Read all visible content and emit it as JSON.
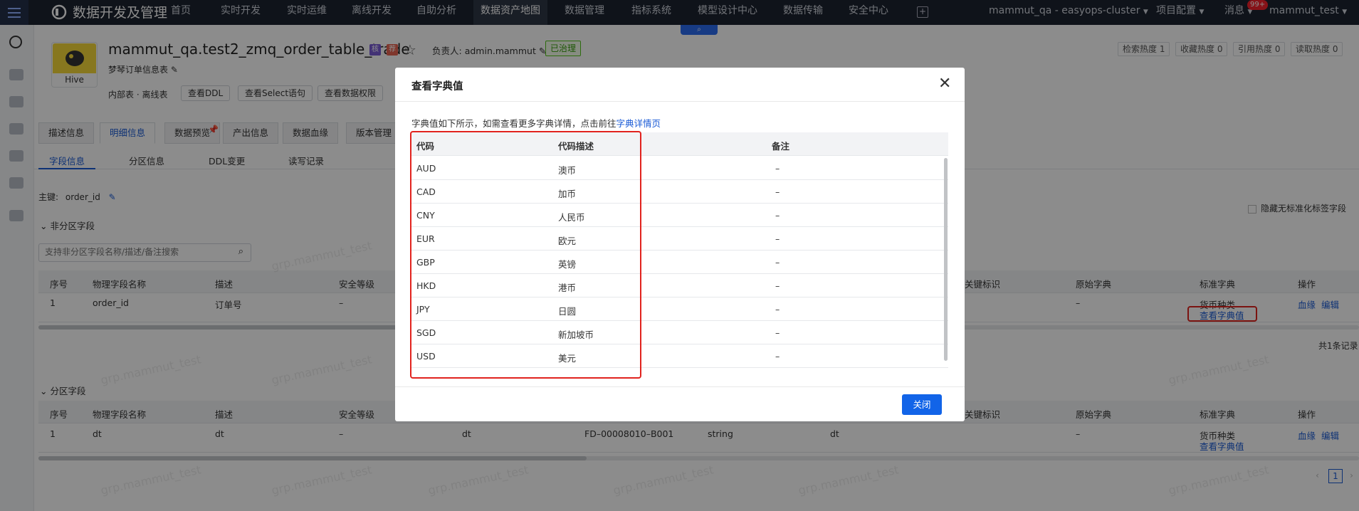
{
  "nav": {
    "brand": "数据开发及管理",
    "items": [
      "首页",
      "实时开发",
      "实时运维",
      "离线开发",
      "自助分析",
      "数据资产地图",
      "数据管理",
      "指标系统",
      "模型设计中心",
      "数据传输",
      "安全中心"
    ],
    "active_index": 5,
    "cluster": "mammut_qa - easyops-cluster",
    "project_config": "项目配置",
    "messages": "消息",
    "message_badge": "99+",
    "user": "mammut_test"
  },
  "table_info": {
    "type_label": "Hive",
    "name": "mammut_qa.test2_zmq_order_table_trade",
    "tag1": "核",
    "tag2": "荐",
    "owner_label": "负责人:",
    "owner": "admin.mammut",
    "status": "已治理",
    "description": "梦琴订单信息表",
    "internal": "内部表",
    "offline": "离线表",
    "buttons": [
      "查看DDL",
      "查看Select语句",
      "查看数据权限"
    ]
  },
  "metrics": [
    "检索热度 1",
    "收藏热度 0",
    "引用热度 0",
    "读取热度 0"
  ],
  "tabs": [
    "描述信息",
    "明细信息",
    "数据预览",
    "产出信息",
    "数据血缘",
    "版本管理"
  ],
  "subtabs": [
    "字段信息",
    "分区信息",
    "DDL变更",
    "读写记录"
  ],
  "primary_key_label": "主键:",
  "primary_key": "order_id",
  "hide_std_label": "隐藏无标准化标签字段",
  "section_non_partition": "非分区字段",
  "search_placeholder": "支持非分区字段名称/描述/备注搜索",
  "section_partition": "分区字段",
  "table_headers": [
    "序号",
    "物理字段名称",
    "描述",
    "安全等级",
    "关键标识",
    "原始字典",
    "标准字典",
    "操作"
  ],
  "row1": {
    "no": "1",
    "name": "order_id",
    "desc": "订单号",
    "level": "–",
    "orig": "–",
    "std": "货币种类",
    "std_link": "查看字典值",
    "op1": "血缘",
    "op2": "编辑"
  },
  "row2": {
    "no": "1",
    "name": "dt",
    "desc": "dt",
    "level": "–",
    "c5": "dt",
    "c6": "FD–00008010–B001",
    "c7": "string",
    "c8": "dt",
    "orig": "–",
    "std": "货币种类",
    "std_link": "查看字典值",
    "op1": "血缘",
    "op2": "编辑"
  },
  "total_records": "共1条记录",
  "page": "1",
  "watermark": "grp.mammut_test",
  "modal": {
    "title": "查看字典值",
    "intro": "字典值如下所示，如需查看更多字典详情，点击前往",
    "intro_link": "字典详情页",
    "headers": [
      "代码",
      "代码描述",
      "备注"
    ],
    "rows": [
      [
        "AUD",
        "澳币",
        "–"
      ],
      [
        "CAD",
        "加币",
        "–"
      ],
      [
        "CNY",
        "人民币",
        "–"
      ],
      [
        "EUR",
        "欧元",
        "–"
      ],
      [
        "GBP",
        "英镑",
        "–"
      ],
      [
        "HKD",
        "港币",
        "–"
      ],
      [
        "JPY",
        "日圆",
        "–"
      ],
      [
        "SGD",
        "新加坡币",
        "–"
      ],
      [
        "USD",
        "美元",
        "–"
      ]
    ],
    "close_label": "关闭"
  }
}
